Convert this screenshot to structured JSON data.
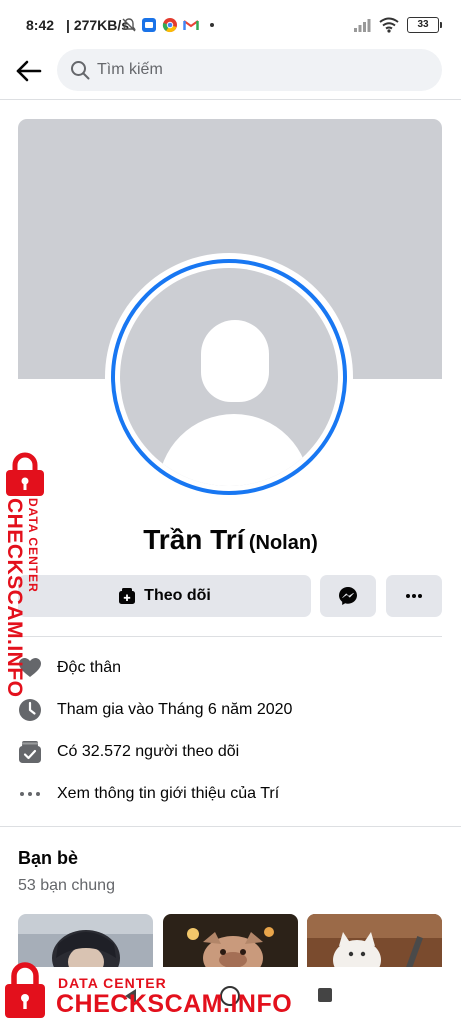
{
  "status_bar": {
    "time": "8:42",
    "speed": "277KB/s",
    "battery": "33",
    "icons": [
      "bell-off-icon",
      "app-icon",
      "chrome-icon",
      "gmail-icon",
      "dot-icon",
      "signal-icon",
      "wifi-icon",
      "battery-icon"
    ]
  },
  "topbar": {
    "search_placeholder": "Tìm kiếm"
  },
  "profile": {
    "name": "Trần Trí",
    "alternate_name": "(Nolan)"
  },
  "actions": {
    "follow_label": "Theo dõi"
  },
  "info": {
    "items": [
      {
        "icon": "heart-icon",
        "text": "Độc thân"
      },
      {
        "icon": "clock-icon",
        "text": "Tham gia vào Tháng 6 năm 2020"
      },
      {
        "icon": "followers-icon",
        "text": "Có 32.572 người theo dõi"
      },
      {
        "icon": "more-dots-icon",
        "text": "Xem thông tin giới thiệu của Trí"
      }
    ]
  },
  "friends": {
    "title": "Bạn bè",
    "mutual": "53 bạn chung"
  },
  "watermark": {
    "small_text": "DATA CENTER",
    "large_text": "CHECKSCAM.INFO"
  },
  "colors": {
    "accent": "#1877f2",
    "button_bg": "#e4e6eb",
    "cover": "#ccced3",
    "watermark": "#e3101c"
  }
}
